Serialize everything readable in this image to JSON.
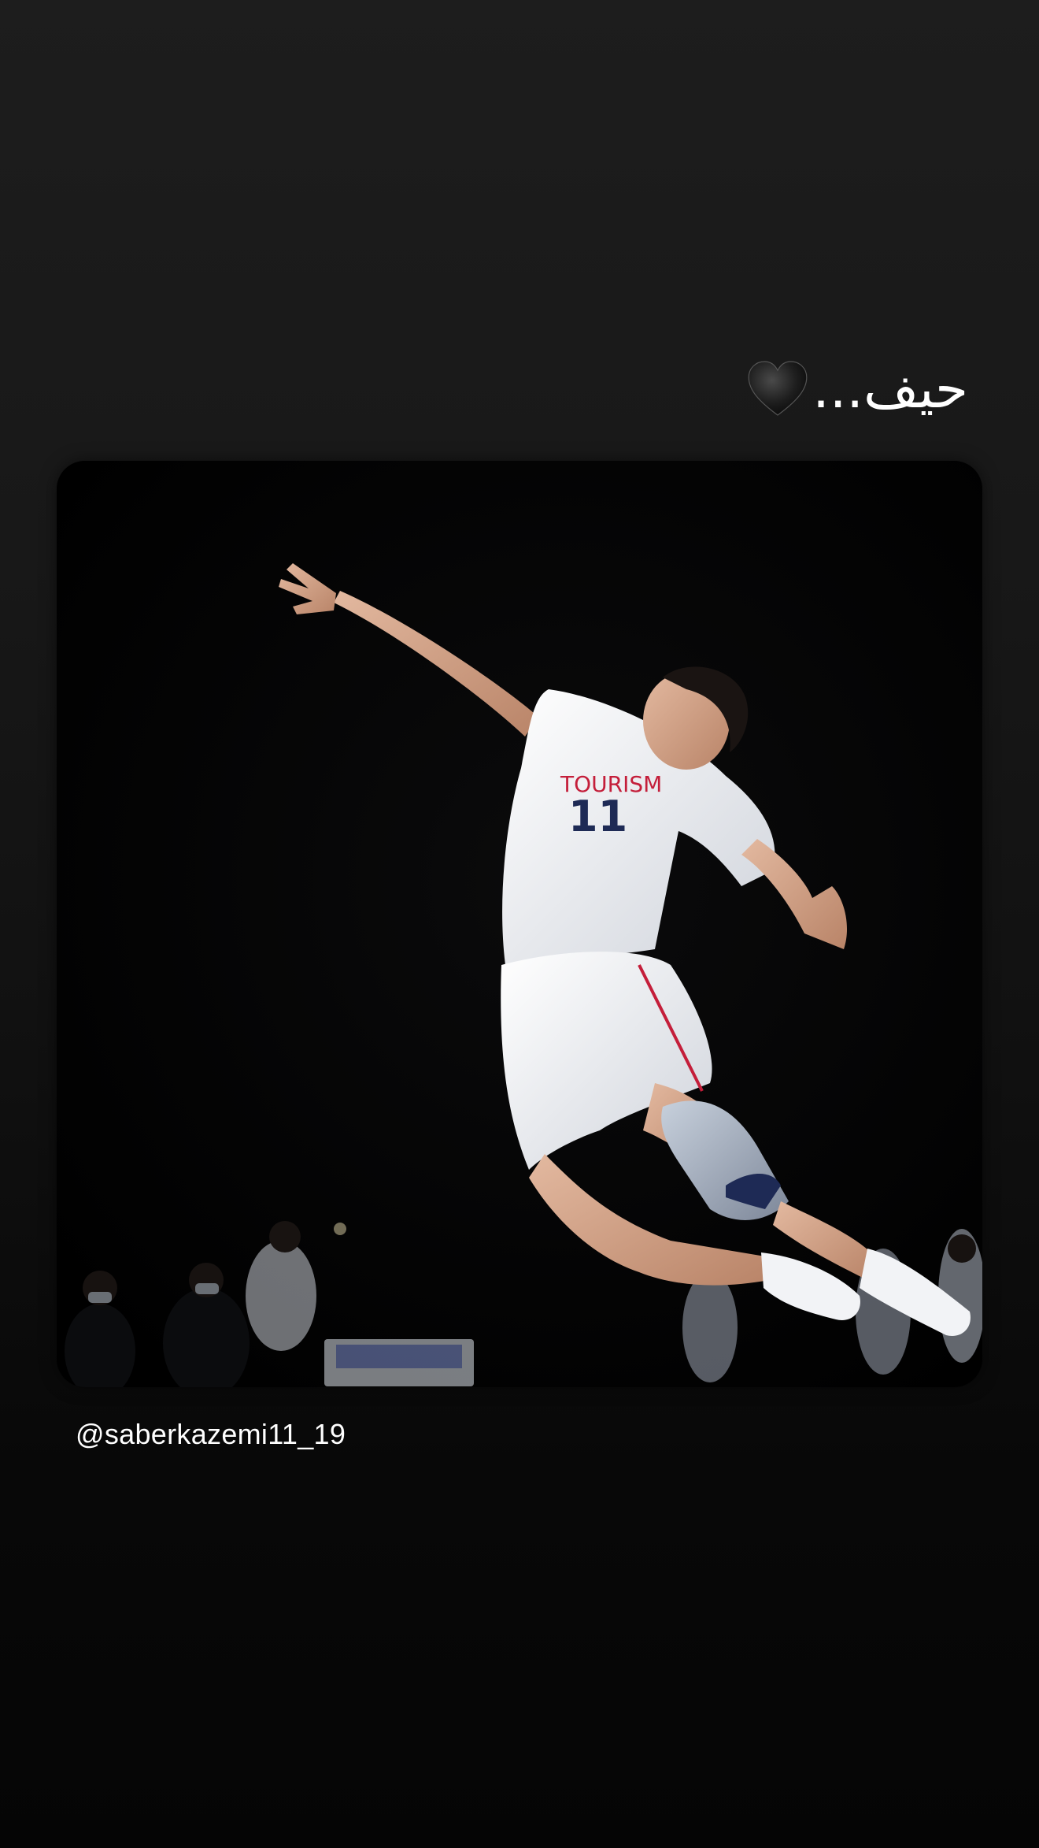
{
  "story": {
    "caption_text": "حیف...",
    "caption_emoji": "black-heart-icon",
    "mention": "@saberkazemi11_19",
    "photo": {
      "subject": "volleyball-player-photo",
      "jersey_number": "11"
    },
    "colors": {
      "background_top": "#1d1d1d",
      "background_bottom": "#050505",
      "text": "#ffffff"
    }
  }
}
